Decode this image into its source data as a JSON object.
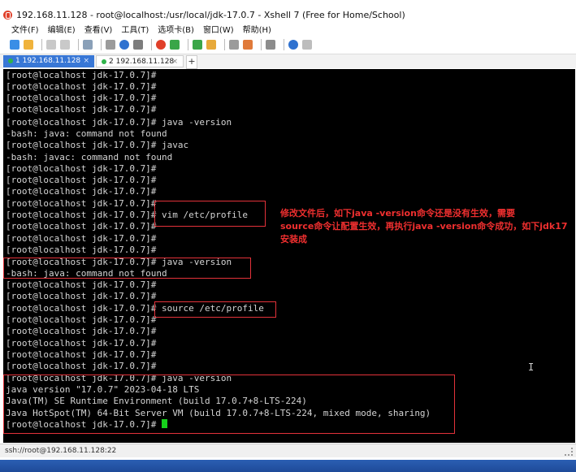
{
  "window": {
    "title": "192.168.11.128 - root@localhost:/usr/local/jdk-17.0.7 - Xshell 7 (Free for Home/School)"
  },
  "menu": [
    "文件(F)",
    "编辑(E)",
    "查看(V)",
    "工具(T)",
    "选项卡(B)",
    "窗口(W)",
    "帮助(H)"
  ],
  "tabs": [
    {
      "label": "1 192.168.11.128",
      "active": true
    },
    {
      "label": "2 192.168.11.128",
      "active": false
    }
  ],
  "terminal": {
    "lines": [
      "[root@localhost jdk-17.0.7]#",
      "[root@localhost jdk-17.0.7]#",
      "[root@localhost jdk-17.0.7]#",
      "[root@localhost jdk-17.0.7]#",
      "[root@localhost jdk-17.0.7]# java -version",
      "-bash: java: command not found",
      "[root@localhost jdk-17.0.7]# javac",
      "-bash: javac: command not found",
      "[root@localhost jdk-17.0.7]#",
      "[root@localhost jdk-17.0.7]#",
      "[root@localhost jdk-17.0.7]#",
      "[root@localhost jdk-17.0.7]#",
      "[root@localhost jdk-17.0.7]# vim /etc/profile",
      "[root@localhost jdk-17.0.7]#",
      "[root@localhost jdk-17.0.7]#",
      "[root@localhost jdk-17.0.7]#",
      "[root@localhost jdk-17.0.7]# java -version",
      "-bash: java: command not found",
      "[root@localhost jdk-17.0.7]#",
      "[root@localhost jdk-17.0.7]#",
      "[root@localhost jdk-17.0.7]# source /etc/profile",
      "[root@localhost jdk-17.0.7]#",
      "[root@localhost jdk-17.0.7]#",
      "[root@localhost jdk-17.0.7]#",
      "[root@localhost jdk-17.0.7]#",
      "[root@localhost jdk-17.0.7]#",
      "[root@localhost jdk-17.0.7]# java -version",
      "java version \"17.0.7\" 2023-04-18 LTS",
      "Java(TM) SE Runtime Environment (build 17.0.7+8-LTS-224)",
      "Java HotSpot(TM) 64-Bit Server VM (build 17.0.7+8-LTS-224, mixed mode, sharing)",
      "[root@localhost jdk-17.0.7]# "
    ],
    "cursor_color": "#16d21b"
  },
  "annotation": {
    "text": "修改文件后，如下java -version命令还是没有生效，需要\nsource命令让配置生效，再执行java -version命令成功，如下jdk17\n安装成",
    "color": "#ef2f2f"
  },
  "status": {
    "text": "ssh://root@192.168.11.128:22"
  },
  "colors": {
    "terminal_bg": "#000000",
    "terminal_fg": "#d4d4d4",
    "highlight_border": "#e3323a",
    "active_tab": "#3877d6"
  },
  "icons": [
    "xshell-app-icon",
    "new-session-icon",
    "open-folder-icon",
    "copy-icon",
    "paste-icon",
    "find-icon",
    "settings-icon",
    "color-icon",
    "font-icon",
    "xftp-icon",
    "fullscreen-icon",
    "lock-icon",
    "keyboard-icon",
    "compose-icon",
    "layout-icon",
    "help-icon",
    "chat-icon"
  ]
}
